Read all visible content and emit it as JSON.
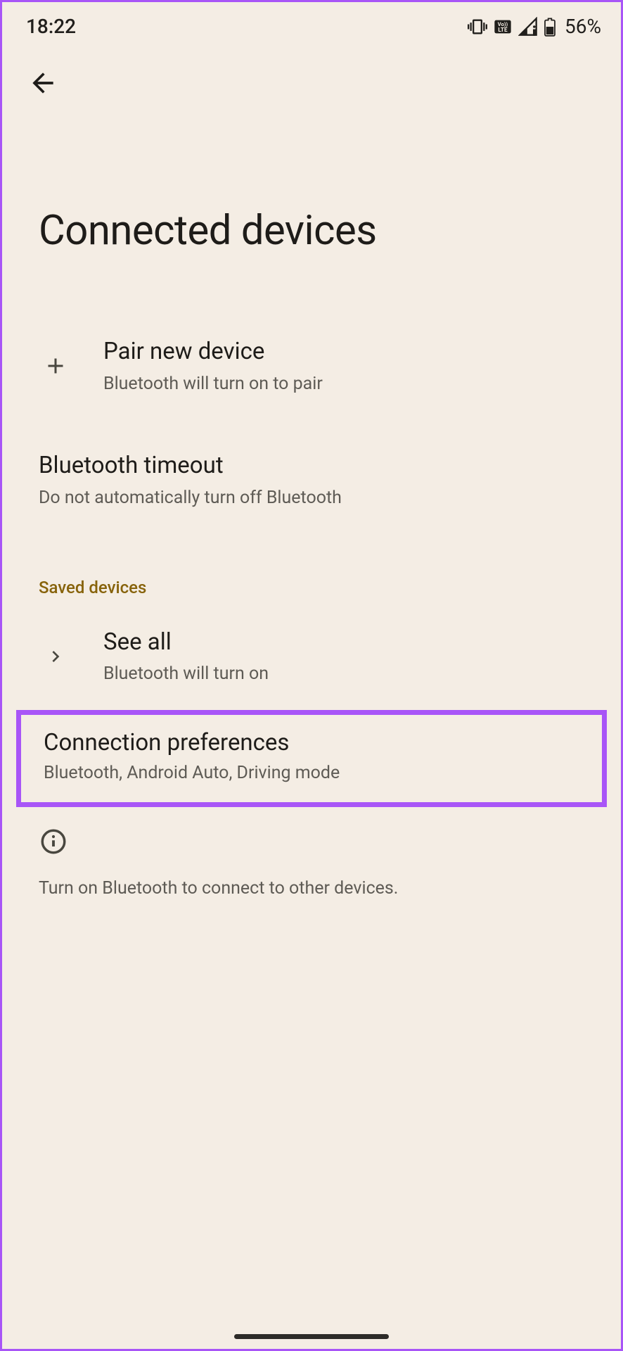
{
  "status": {
    "time": "18:22",
    "battery": "56%"
  },
  "page": {
    "title": "Connected devices"
  },
  "items": {
    "pair": {
      "title": "Pair new device",
      "subtitle": "Bluetooth will turn on to pair"
    },
    "timeout": {
      "title": "Bluetooth timeout",
      "subtitle": "Do not automatically turn off Bluetooth"
    },
    "seeall": {
      "title": "See all",
      "subtitle": "Bluetooth will turn on"
    },
    "preferences": {
      "title": "Connection preferences",
      "subtitle": "Bluetooth, Android Auto, Driving mode"
    }
  },
  "sections": {
    "saved": "Saved devices"
  },
  "info": {
    "text": "Turn on Bluetooth to connect to other devices."
  }
}
